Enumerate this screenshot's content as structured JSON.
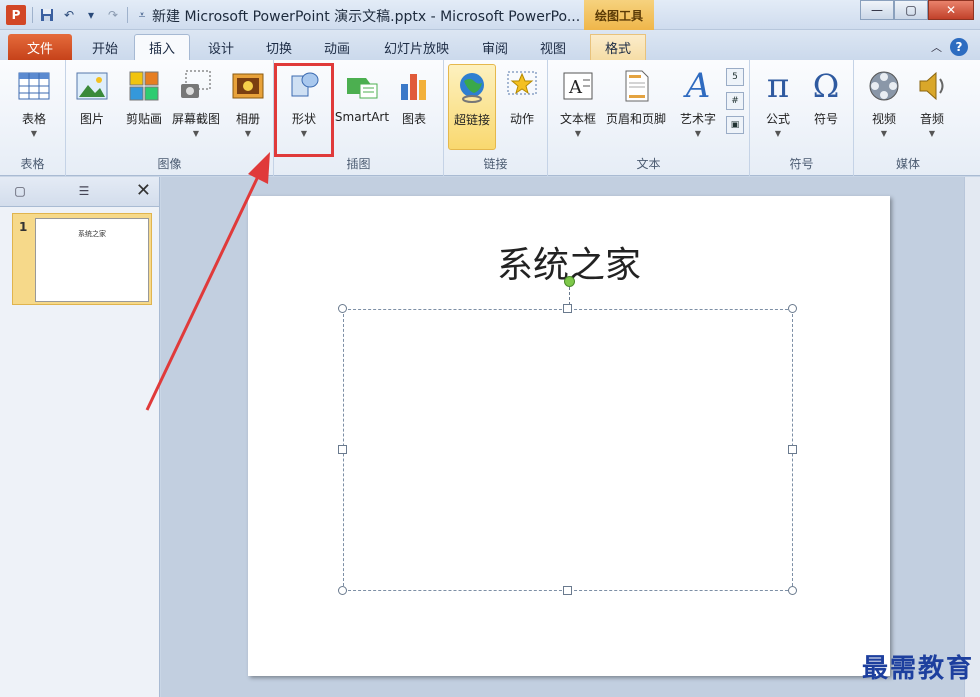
{
  "titlebar": {
    "title": "新建 Microsoft PowerPoint 演示文稿.pptx - Microsoft PowerPo...",
    "app_logo": "P",
    "tool_tab": "绘图工具"
  },
  "tabs": {
    "file": "文件",
    "home": "开始",
    "insert": "插入",
    "design": "设计",
    "transitions": "切换",
    "animations": "动画",
    "slideshow": "幻灯片放映",
    "review": "审阅",
    "view": "视图",
    "format": "格式"
  },
  "ribbon": {
    "table": "表格",
    "picture": "图片",
    "clipart": "剪贴画",
    "screenshot": "屏幕截图",
    "album": "相册",
    "shapes": "形状",
    "smartart": "SmartArt",
    "chart": "图表",
    "hyperlink": "超链接",
    "action": "动作",
    "textbox": "文本框",
    "header_footer": "页眉和页脚",
    "wordart": "艺术字",
    "equation": "公式",
    "symbol": "符号",
    "video": "视频",
    "audio": "音频",
    "groups": {
      "tables": "表格",
      "images": "图像",
      "illustrations": "插图",
      "links": "链接",
      "text": "文本",
      "symbols": "符号",
      "media": "媒体"
    },
    "equation_glyph": "π",
    "symbol_glyph": "Ω",
    "wordart_glyph": "A"
  },
  "slide_panel": {
    "slide_number": "1",
    "thumb_title": "系统之家"
  },
  "slide": {
    "title": "系统之家"
  },
  "watermark": "最需教育"
}
